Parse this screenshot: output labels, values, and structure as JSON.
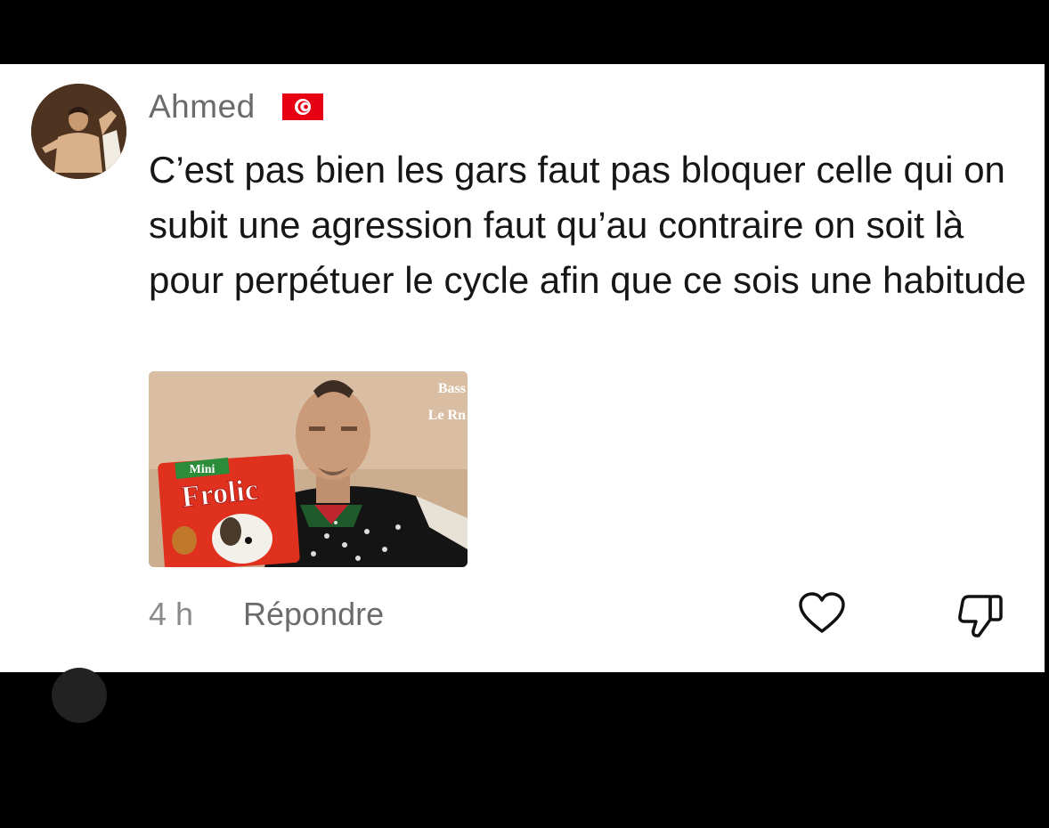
{
  "comment": {
    "author": "Ahmed",
    "text": "C’est pas bien les gars faut pas bloquer celle qui on subit une agression faut qu’au contraire on soit là pour perpétuer le cycle afin que ce sois une habitude",
    "time": "4 h",
    "reply_label": "Répondre",
    "media": {
      "overlay_line1": "Bass",
      "overlay_line2": "Le Rn",
      "package_small": "Mini",
      "package_brand": "Frolic"
    }
  },
  "icons": {
    "flag": "tunisia-flag-icon",
    "like": "heart-icon",
    "dislike": "thumbs-down-icon"
  },
  "colors": {
    "background": "#000000",
    "card": "#ffffff",
    "text": "#161616",
    "muted": "#8a8a8a",
    "flag_red": "#e70013"
  }
}
